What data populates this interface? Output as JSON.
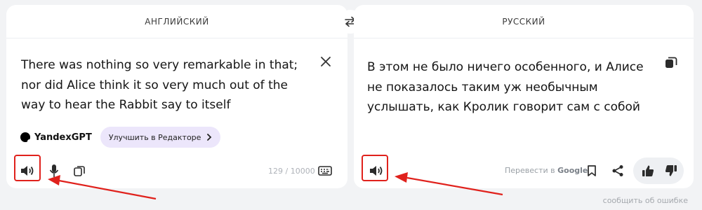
{
  "source": {
    "language": "АНГЛИЙСКИЙ",
    "text": "There was nothing so very remarkable in that; nor did Alice think it so very much out of the way to hear the Rabbit say to itself",
    "counter": "129 / 10000",
    "gpt_name": "YandexGPT",
    "improve_label": "Улучшить в Редакторе"
  },
  "target": {
    "language": "РУССКИЙ",
    "text": "В этом не было ничего особенного, и Алисе не показалось таким уж необычным услышать, как Кролик говорит сам с собой",
    "google_prefix": "Перевести в ",
    "google_name": "Google"
  },
  "footer": {
    "report_label": "сообщить об ошибке"
  },
  "colors": {
    "highlight": "#e0211c",
    "accent": "#ece6fb"
  },
  "icons": [
    "swap-icon",
    "clear-icon",
    "copy-icon",
    "speaker-icon",
    "mic-icon",
    "keyboard-icon",
    "bookmark-icon",
    "share-icon",
    "thumbs-up-icon",
    "thumbs-down-icon"
  ]
}
